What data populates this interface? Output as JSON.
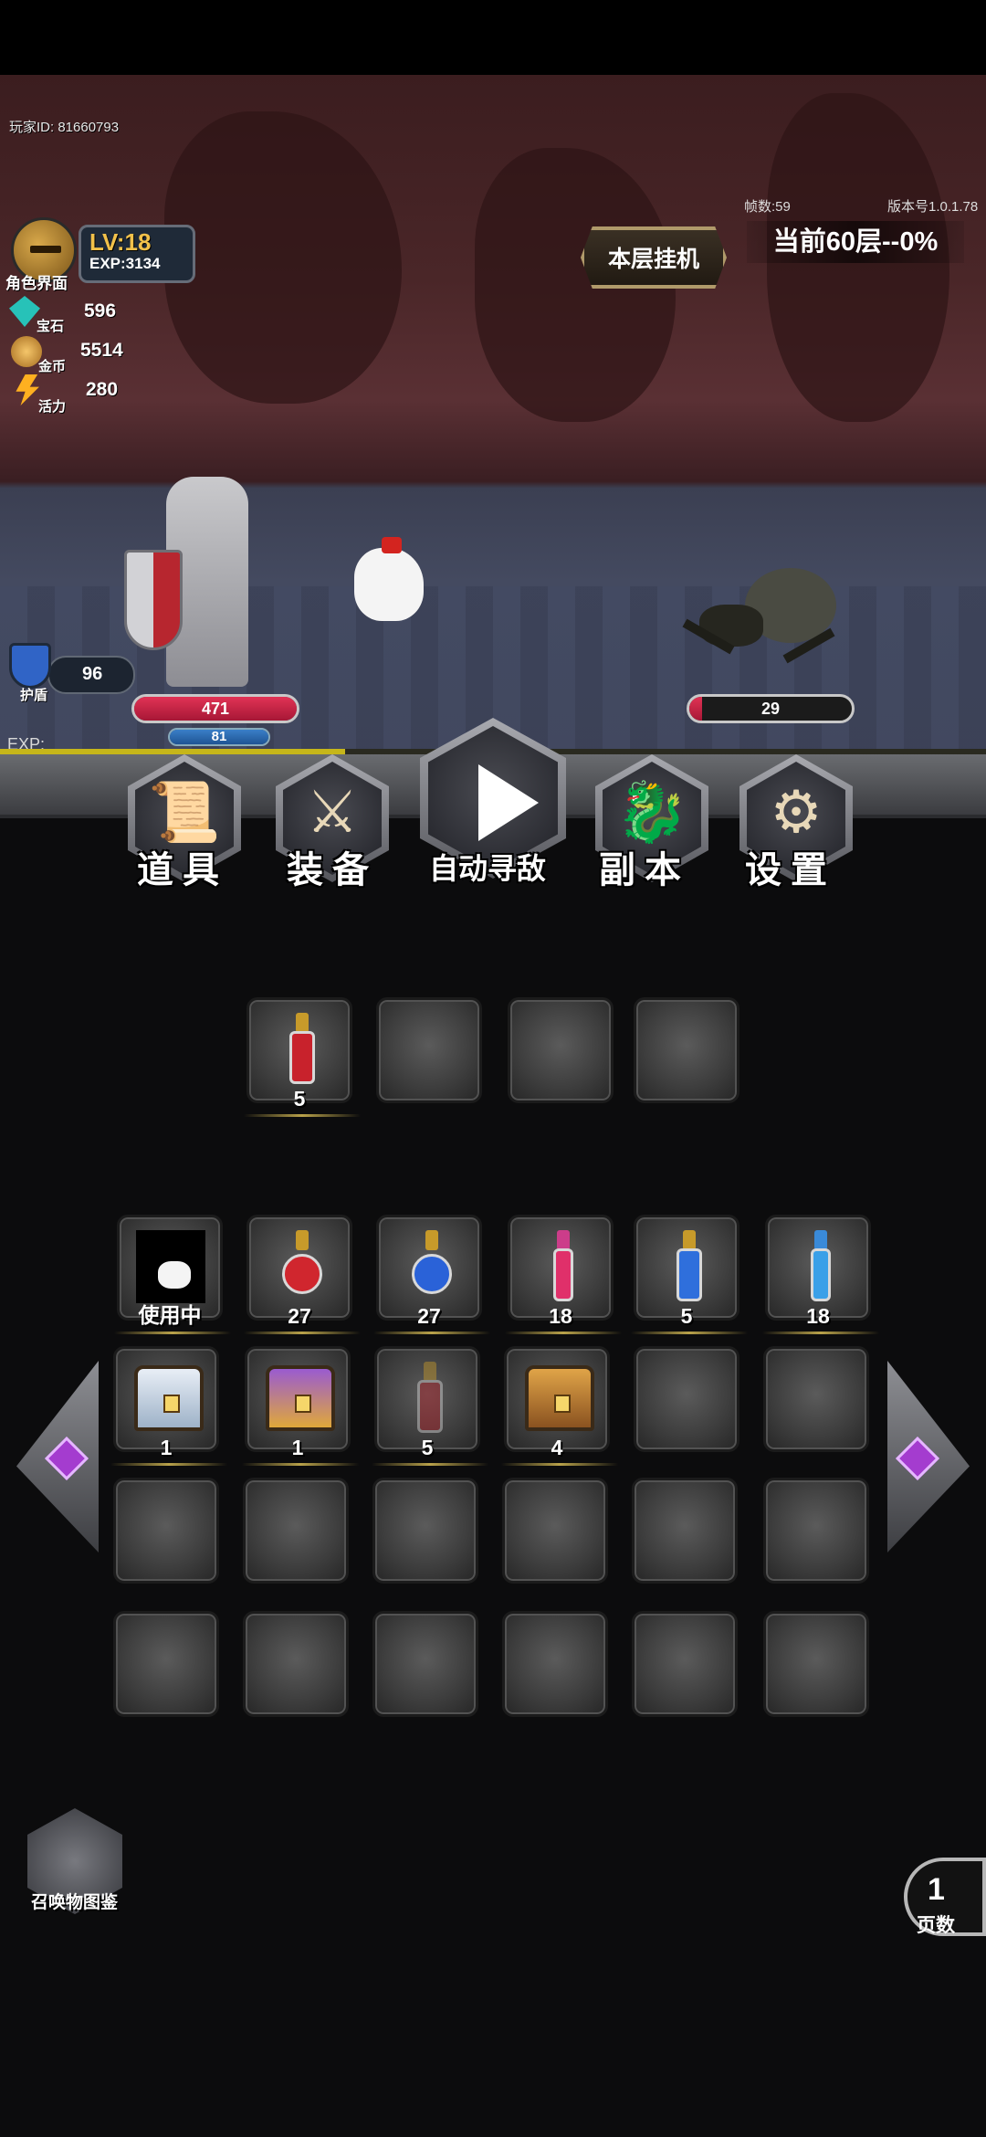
{
  "hud": {
    "player_id": "玩家ID:  81660793",
    "level_prefix": "LV:",
    "level": "18",
    "exp": "EXP:3134",
    "role_label": "角色界面",
    "gems_label": "宝石",
    "gems": "596",
    "gold_label": "金币",
    "gold": "5514",
    "energy_label": "活力",
    "energy": "280",
    "fps": "帧数:59",
    "version": "版本号1.0.1.78",
    "floor_button": "本层挂机",
    "floor_progress": "当前60层--0%",
    "shield_label": "护盾",
    "shield": "96",
    "exp_bar_label": "EXP:",
    "exp_fraction": 0.35
  },
  "player": {
    "hp": "471",
    "mp": "81",
    "hp_fraction": 1.0,
    "mp_fraction": 1.0
  },
  "enemy": {
    "hp": "29",
    "hp_fraction": 0.08
  },
  "menu": {
    "items": "道具",
    "equipment": "装备",
    "auto_battle": "自动寻敌",
    "dungeon": "副本",
    "settings": "设置"
  },
  "equipped": [
    {
      "item": "red-potion",
      "count": "5"
    },
    {
      "item": "",
      "count": ""
    },
    {
      "item": "",
      "count": ""
    },
    {
      "item": "",
      "count": ""
    }
  ],
  "inventory": {
    "row1": [
      {
        "item": "chicken",
        "count": "使用中"
      },
      {
        "item": "red-round-potion",
        "count": "27"
      },
      {
        "item": "blue-round-potion",
        "count": "27"
      },
      {
        "item": "pink-vial",
        "count": "18"
      },
      {
        "item": "blue-potion",
        "count": "5"
      },
      {
        "item": "blue-vial",
        "count": "18"
      }
    ],
    "row2": [
      {
        "item": "silver-chest",
        "count": "1"
      },
      {
        "item": "purple-chest",
        "count": "1"
      },
      {
        "item": "red-potion-faded",
        "count": "5"
      },
      {
        "item": "wooden-chest",
        "count": "4"
      }
    ]
  },
  "bestiary_label": "召唤物图鉴",
  "page": {
    "number": "1",
    "label": "页数"
  },
  "colors": {
    "hp": "#e13355",
    "mp": "#3a7fc8",
    "exp": "#c6b61a",
    "level": "#f2c14a"
  }
}
